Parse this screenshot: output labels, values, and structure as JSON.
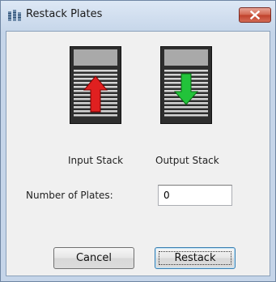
{
  "window": {
    "title": "Restack Plates"
  },
  "stacks": {
    "input": {
      "label": "Input Stack",
      "arrow_color": "#e02020",
      "arrow_dir": "up"
    },
    "output": {
      "label": "Output Stack",
      "arrow_color": "#22c33a",
      "arrow_dir": "down"
    }
  },
  "plates": {
    "label": "Number of Plates:",
    "value": "0"
  },
  "buttons": {
    "cancel": "Cancel",
    "restack": "Restack"
  },
  "icons": {
    "app": "stacked-plates-icon",
    "close": "close-icon"
  }
}
